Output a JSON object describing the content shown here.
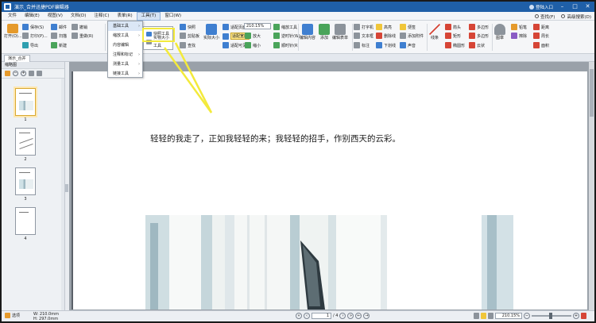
{
  "app": {
    "title": "演示_合并迅捷PDF编辑器",
    "login_label": "登陆入口",
    "colors": {
      "titlebar": "#1f5fa7",
      "highlight": "#f3ea3c"
    }
  },
  "menubar": {
    "items": [
      "文件",
      "编辑(E)",
      "视图(V)",
      "文档(D)",
      "注释(C)",
      "表单(R)",
      "工具(T)",
      "窗口(W)"
    ],
    "right_items": [
      "查找(F)",
      "高级搜索(D)"
    ]
  },
  "ribbon": {
    "open": "打开(O)...",
    "save": "保存(S)",
    "print": "打印(P)...",
    "export": "导出",
    "mail": "邮件",
    "scan": "扫描",
    "new": "新建",
    "undo": "撤销",
    "redo": "重做(R)",
    "select": "选择",
    "snapshot": "快照",
    "clipboard": "剪贴板",
    "find": "查找",
    "actual_size": "实际大小",
    "fit_page": "适配页面",
    "fit_width": "适配宽度",
    "fit_visible": "适配可见",
    "zoom_value": "210.15%",
    "zoom_in": "放大",
    "zoom_out": "缩小",
    "zoom_tool": "缩放工具",
    "rotate_view": "旋转视图",
    "rotate_left": "逆时针(W)",
    "rotate_right": "顺时针(R)",
    "edit_content": "编辑内容",
    "add": "添加",
    "edit_form": "编辑表单",
    "typewriter": "打字机",
    "textbox": "文本框",
    "callout": "标注",
    "highlight": "高亮",
    "strikeout": "删除线",
    "underline": "下划线",
    "note": "便签",
    "attach_file": "添加附件",
    "sound": "声音",
    "line": "线条",
    "arrow": "箭头",
    "rectangle": "矩形",
    "ellipse": "椭圆形",
    "polygon": "多边形",
    "polyline": "多边形",
    "cloud": "云状",
    "stamp": "图章",
    "distance": "距离",
    "perimeter": "周长",
    "area": "面积",
    "pencil": "铅笔",
    "eraser": "擦除",
    "linked": "链接"
  },
  "tools_menu": {
    "items": [
      "基础工具",
      "缩放工具",
      "内容编辑",
      "注释和标记",
      "测量工具",
      "链接工具"
    ],
    "submenu": [
      "快照工具",
      "实物大小工具"
    ]
  },
  "tab": {
    "doc_name": "演示_合并"
  },
  "sidebar": {
    "title": "缩略图",
    "pages": [
      "1",
      "2",
      "3",
      "4"
    ]
  },
  "viewer": {
    "text": "轻轻的我走了，正如我轻轻的来；我轻轻的招手，作别西天的云彩。"
  },
  "status": {
    "select_mode": "选项",
    "width": "W: 210.0mm",
    "height": "H: 297.0mm",
    "current_page": "1",
    "total_pages": "/ 4",
    "zoom": "210.15%"
  }
}
